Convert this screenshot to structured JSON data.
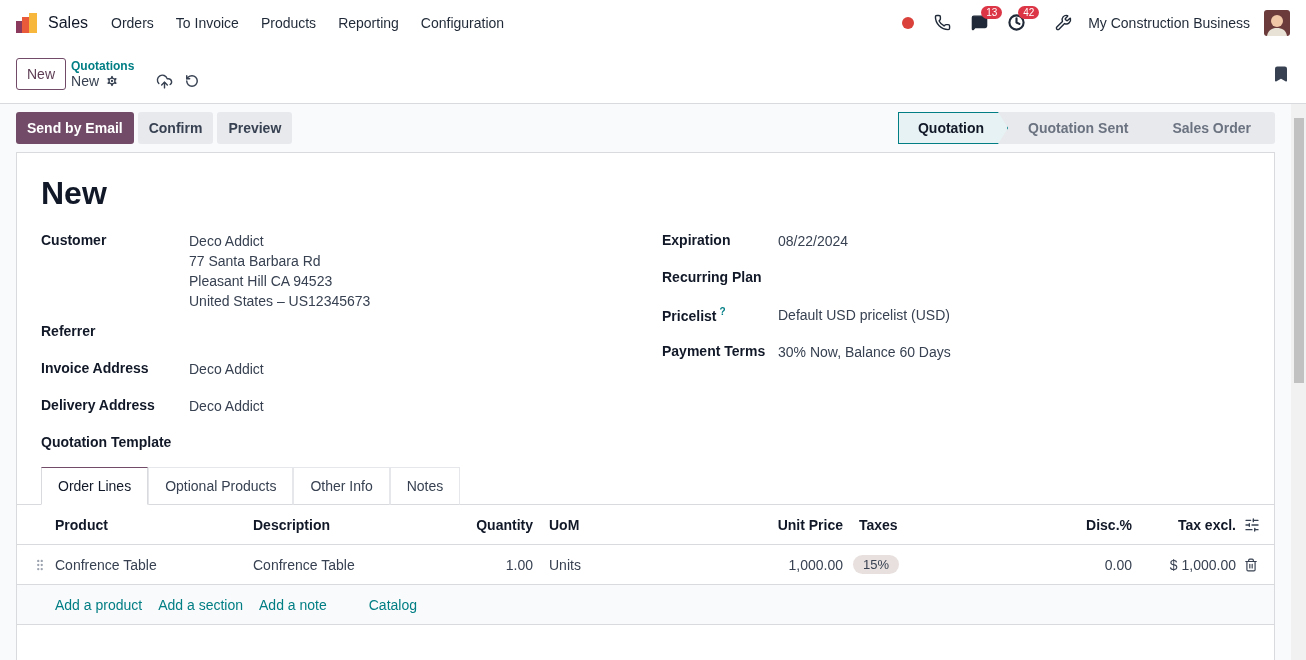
{
  "navbar": {
    "app": "Sales",
    "menu": [
      "Orders",
      "To Invoice",
      "Products",
      "Reporting",
      "Configuration"
    ],
    "badges": [
      {
        "kind": "chat",
        "count": "13"
      },
      {
        "kind": "activity",
        "count": "42"
      }
    ],
    "company": "My Construction Business"
  },
  "control_panel": {
    "new_button": "New",
    "breadcrumb": "Quotations",
    "record": "New"
  },
  "actions": [
    {
      "label": "Send by Email",
      "primary": true
    },
    {
      "label": "Confirm",
      "primary": false
    },
    {
      "label": "Preview",
      "primary": false
    }
  ],
  "stages": [
    {
      "label": "Quotation",
      "selected": true
    },
    {
      "label": "Quotation Sent",
      "selected": false
    },
    {
      "label": "Sales Order",
      "selected": false
    }
  ],
  "form": {
    "title": "New",
    "left_fields": [
      {
        "label": "Customer",
        "lines": [
          "Deco Addict",
          "77 Santa Barbara Rd",
          "Pleasant Hill CA 94523",
          "United States – US12345673"
        ]
      },
      {
        "label": "Referrer"
      },
      {
        "label": "Invoice Address",
        "lines": [
          "Deco Addict"
        ]
      },
      {
        "label": "Delivery Address",
        "lines": [
          "Deco Addict"
        ]
      },
      {
        "label": "Quotation Template"
      }
    ],
    "right_fields": [
      {
        "label": "Expiration",
        "value": "08/22/2024"
      },
      {
        "label": "Recurring Plan"
      },
      {
        "label": "Pricelist",
        "help": "?",
        "value": "Default USD pricelist (USD)"
      },
      {
        "label": "Payment Terms",
        "value": "30% Now, Balance 60 Days"
      }
    ]
  },
  "tabs": [
    {
      "label": "Order Lines",
      "selected": true
    },
    {
      "label": "Optional Products",
      "selected": false
    },
    {
      "label": "Other Info",
      "selected": false
    },
    {
      "label": "Notes",
      "selected": false
    }
  ],
  "table": {
    "columns": [
      "Product",
      "Description",
      "Quantity",
      "UoM",
      "Unit Price",
      "Taxes",
      "Disc.%",
      "Tax excl."
    ],
    "rows": [
      {
        "product": "Confrence Table",
        "description": "Confrence Table",
        "quantity": "1.00",
        "uom": "Units",
        "unit_price": "1,000.00",
        "taxes": "15%",
        "discount": "0.00",
        "subtotal": "$ 1,000.00"
      }
    ],
    "add_links": [
      "Add a product",
      "Add a section",
      "Add a note",
      "Catalog"
    ]
  }
}
